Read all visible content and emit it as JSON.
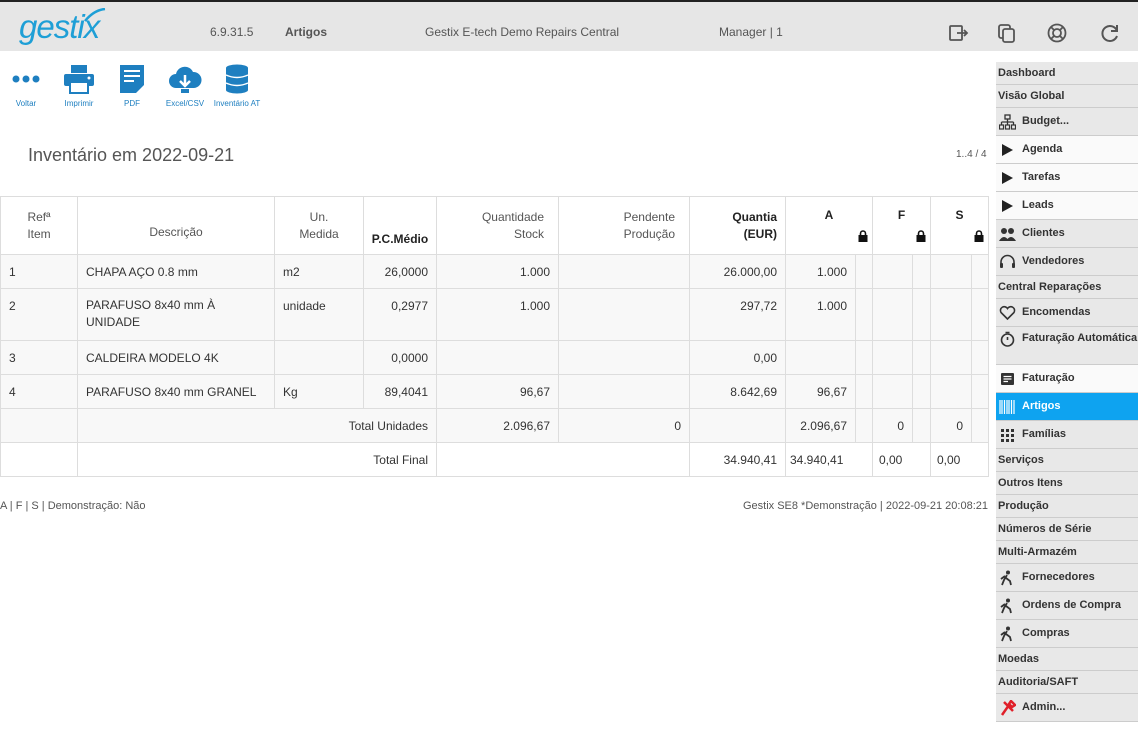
{
  "header": {
    "logo": "gestix",
    "version": "6.9.31.5",
    "section": "Artigos",
    "company": "Gestix E-tech Demo Repairs Central",
    "user": "Manager | 1",
    "icons": [
      "logout-icon",
      "copy-window-icon",
      "help-lifebuoy-icon",
      "refresh-icon"
    ]
  },
  "toolbar": {
    "voltar": "Voltar",
    "imprimir": "Imprimir",
    "pdf": "PDF",
    "excel": "Excel/CSV",
    "inventario": "Inventário AT"
  },
  "page": {
    "title": "Inventário em 2022-09-21",
    "count": "1..4 / 4"
  },
  "table": {
    "headers": {
      "ref": "Refª Item",
      "descricao": "Descrição",
      "unidade": "Un. Medida",
      "pcmedio": "P.C.Médio",
      "qtd_stock": "Quantidade Stock",
      "pendente": "Pendente Produção",
      "quantia": "Quantia (EUR)",
      "a": "A",
      "f": "F",
      "s": "S"
    },
    "rows": [
      {
        "ref": "1",
        "desc": "CHAPA AÇO 0.8 mm",
        "un": "m2",
        "pc": "26,0000",
        "stock": "1.000",
        "pend": "",
        "quantia": "26.000,00",
        "a": "1.000"
      },
      {
        "ref": "2",
        "desc": "PARAFUSO 8x40 mm À UNIDADE",
        "un": "unidade",
        "pc": "0,2977",
        "stock": "1.000",
        "pend": "",
        "quantia": "297,72",
        "a": "1.000"
      },
      {
        "ref": "3",
        "desc": "CALDEIRA MODELO 4K",
        "un": "",
        "pc": "0,0000",
        "stock": "",
        "pend": "",
        "quantia": "0,00",
        "a": ""
      },
      {
        "ref": "4",
        "desc": "PARAFUSO 8x40 mm GRANEL",
        "un": "Kg",
        "pc": "89,4041",
        "stock": "96,67",
        "pend": "",
        "quantia": "8.642,69",
        "a": "96,67"
      }
    ],
    "total_unidades": {
      "label": "Total Unidades",
      "stock": "2.096,67",
      "pend": "0",
      "a": "2.096,67",
      "f": "0",
      "s": "0"
    },
    "total_final": {
      "label": "Total Final",
      "quantia": "34.940,41",
      "a": "34.940,41",
      "f": "0,00",
      "s": "0,00"
    }
  },
  "footer": {
    "left": "A | F | S | Demonstração: Não",
    "right": "Gestix SE8 *Demonstração | 2022-09-21 20:08:21"
  },
  "sidebar": {
    "dashboard": "Dashboard",
    "visao": "Visão Global",
    "budget": "Budget...",
    "agenda": "Agenda",
    "tarefas": "Tarefas",
    "leads": "Leads",
    "clientes": "Clientes",
    "vendedores": "Vendedores",
    "central": "Central Reparações",
    "encomendas": "Encomendas",
    "faturacao_auto": "Faturação Automática",
    "faturacao": "Faturação",
    "artigos": "Artigos",
    "familias": "Famílias",
    "servicos": "Serviços",
    "outros": "Outros Itens",
    "producao": "Produção",
    "numeros": "Números de Série",
    "multi": "Multi-Armazém",
    "fornecedores": "Fornecedores",
    "ordens": "Ordens de Compra",
    "compras": "Compras",
    "moedas": "Moedas",
    "auditoria": "Auditoria/SAFT",
    "admin": "Admin..."
  },
  "colors": {
    "accent": "#1e9fd6",
    "active": "#0ea3f0",
    "admin": "#e0202a"
  }
}
